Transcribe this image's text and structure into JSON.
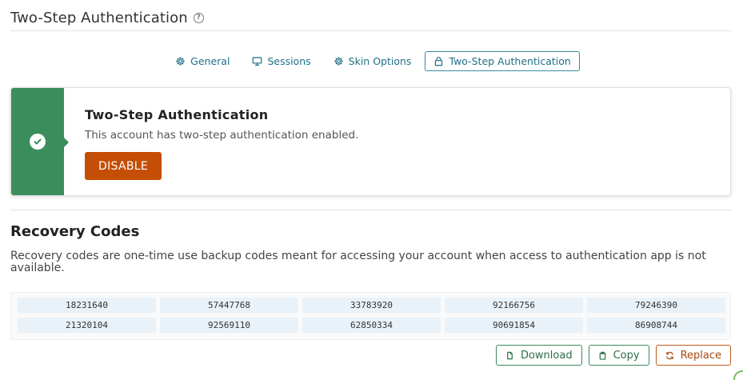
{
  "header": {
    "title": "Two-Step Authentication"
  },
  "tabs": [
    {
      "label": "General",
      "icon": "gear-icon",
      "active": false
    },
    {
      "label": "Sessions",
      "icon": "monitor-icon",
      "active": false
    },
    {
      "label": "Skin Options",
      "icon": "gear-icon",
      "active": false
    },
    {
      "label": "Two-Step Authentication",
      "icon": "lock-icon",
      "active": true
    }
  ],
  "status": {
    "title": "Two-Step Authentication",
    "description": "This account has two-step authentication enabled.",
    "disable_label": "DISABLE",
    "band_color": "#3a8e5c",
    "button_color": "#c44e06"
  },
  "recovery": {
    "title": "Recovery Codes",
    "description": "Recovery codes are one-time use backup codes meant for accessing your account when access to authentication app is not available.",
    "codes": [
      [
        "18231640",
        "57447768",
        "33783920",
        "92166756",
        "79246390"
      ],
      [
        "21320104",
        "92569110",
        "62850334",
        "90691854",
        "86908744"
      ]
    ]
  },
  "actions": {
    "download_label": "Download",
    "copy_label": "Copy",
    "replace_label": "Replace"
  }
}
